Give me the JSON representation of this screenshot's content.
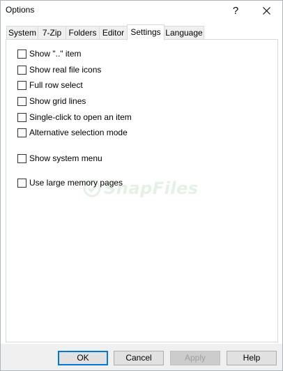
{
  "window": {
    "title": "Options",
    "help_glyph": "?"
  },
  "tabs": [
    {
      "label": "System",
      "active": false
    },
    {
      "label": "7-Zip",
      "active": false
    },
    {
      "label": "Folders",
      "active": false
    },
    {
      "label": "Editor",
      "active": false
    },
    {
      "label": "Settings",
      "active": true
    },
    {
      "label": "Language",
      "active": false
    }
  ],
  "settings": {
    "options": [
      {
        "label": "Show \"..\" item",
        "checked": false
      },
      {
        "label": "Show real file icons",
        "checked": false
      },
      {
        "label": "Full row select",
        "checked": false
      },
      {
        "label": "Show grid lines",
        "checked": false
      },
      {
        "label": "Single-click to open an item",
        "checked": false
      },
      {
        "label": "Alternative selection mode",
        "checked": false
      },
      {
        "label": "Show system menu",
        "checked": false
      },
      {
        "label": "Use large memory pages",
        "checked": false
      }
    ]
  },
  "watermark": {
    "text": "SnapFiles"
  },
  "buttons": {
    "ok": "OK",
    "cancel": "Cancel",
    "apply": "Apply",
    "help": "Help"
  },
  "colors": {
    "accent": "#0078d7",
    "watermark": "#2f8a3a"
  }
}
